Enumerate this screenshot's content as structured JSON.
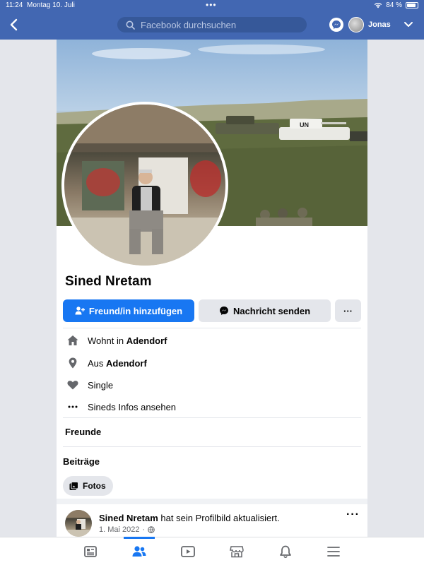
{
  "status_bar": {
    "time": "11:24",
    "date": "Montag 10. Juli",
    "battery": "84 %",
    "battery_level": 0.84
  },
  "header": {
    "search_placeholder": "Facebook durchsuchen",
    "user_name": "Jonas"
  },
  "profile": {
    "name": "Sined Nretam",
    "add_friend_label": "Freund/in hinzufügen",
    "message_label": "Nachricht senden",
    "more_label": "···"
  },
  "intro": {
    "lives_prefix": "Wohnt in ",
    "lives_place": "Adendorf",
    "from_prefix": "Aus ",
    "from_place": "Adendorf",
    "relationship": "Single",
    "see_info": "Sineds Infos ansehen"
  },
  "sections": {
    "friends": "Freunde",
    "posts": "Beiträge",
    "photos_chip": "Fotos"
  },
  "cover_banner": {
    "vehicle_marking": "UN"
  },
  "post": {
    "author": "Sined Nretam",
    "action": " hat sein Profilbild aktualisiert.",
    "date": "1. Mai 2022",
    "separator": "·",
    "more": "···"
  },
  "nav": {
    "tabs": [
      "feed-icon",
      "friends-icon",
      "watch-icon",
      "marketplace-icon",
      "notifications-icon",
      "menu-icon"
    ],
    "active": "friends-icon"
  },
  "colors": {
    "brand": "#4267b2",
    "primary_button": "#1877f2",
    "secondary_button": "#e4e6eb"
  }
}
